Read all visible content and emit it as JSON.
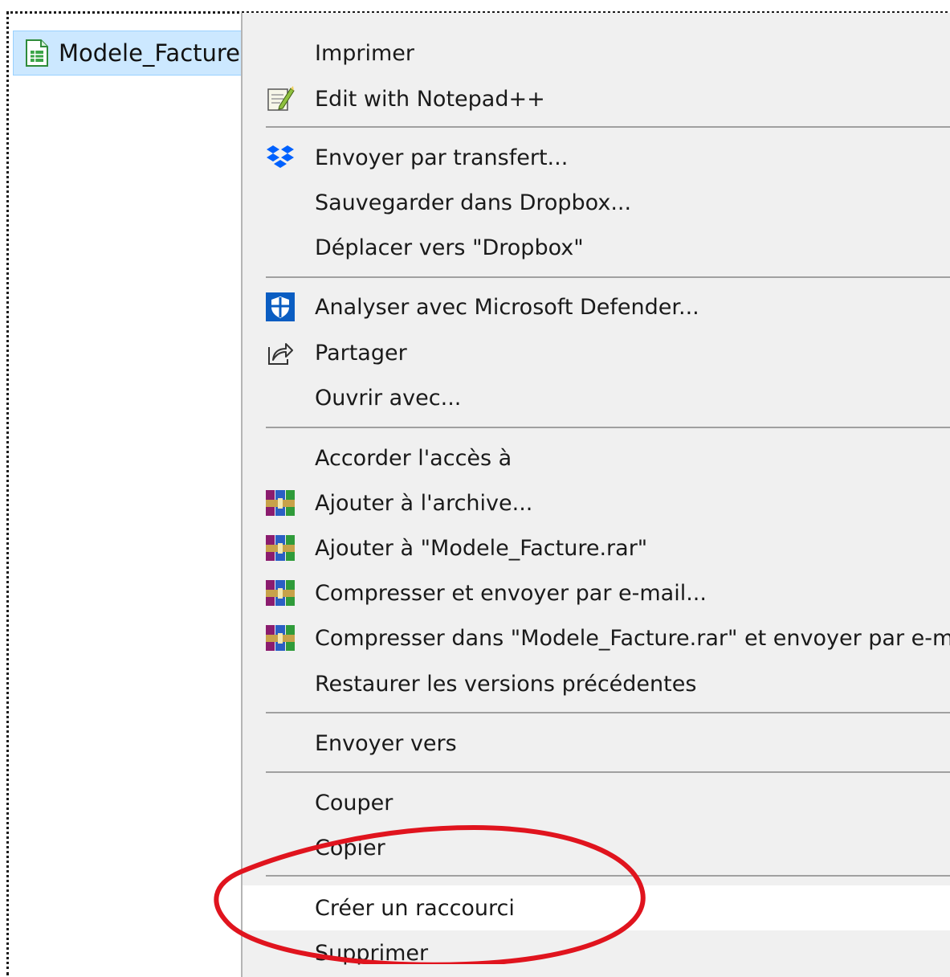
{
  "file": {
    "name": "Modele_Facture.",
    "icon": "spreadsheet-file-icon"
  },
  "menu": {
    "items": [
      {
        "label": "Imprimer",
        "icon": null
      },
      {
        "label": "Edit with Notepad++",
        "icon": "notepadpp-icon"
      },
      {
        "label": "Envoyer par transfert...",
        "icon": "dropbox-icon"
      },
      {
        "label": "Sauvegarder dans Dropbox...",
        "icon": null
      },
      {
        "label": "Déplacer vers \"Dropbox\"",
        "icon": null
      },
      {
        "label": "Analyser avec Microsoft Defender...",
        "icon": "defender-shield-icon"
      },
      {
        "label": "Partager",
        "icon": "share-icon"
      },
      {
        "label": "Ouvrir avec...",
        "icon": null
      },
      {
        "label": "Accorder l'accès à",
        "icon": null
      },
      {
        "label": "Ajouter à l'archive...",
        "icon": "winrar-icon"
      },
      {
        "label": "Ajouter à \"Modele_Facture.rar\"",
        "icon": "winrar-icon"
      },
      {
        "label": "Compresser et envoyer par e-mail...",
        "icon": "winrar-icon"
      },
      {
        "label": "Compresser dans \"Modele_Facture.rar\" et envoyer par e-ma",
        "icon": "winrar-icon"
      },
      {
        "label": "Restaurer les versions précédentes",
        "icon": null
      },
      {
        "label": "Envoyer vers",
        "icon": null
      },
      {
        "label": "Couper",
        "icon": null
      },
      {
        "label": "Copier",
        "icon": null
      },
      {
        "label": "Créer un raccourci",
        "icon": null,
        "hovered": true
      },
      {
        "label": "Supprimer",
        "icon": null
      }
    ]
  },
  "colors": {
    "menu_background": "#f0f0f0",
    "selection_background": "#cce8ff",
    "hover_background": "#ffffff",
    "annotation_circle": "#e0141e"
  }
}
